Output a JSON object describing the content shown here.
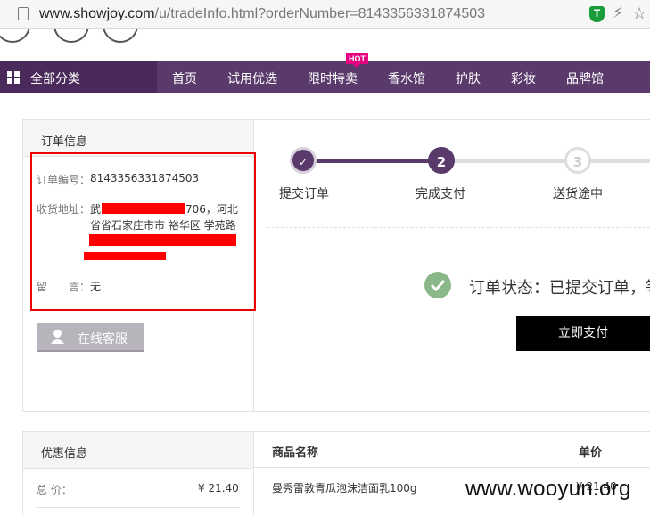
{
  "browser": {
    "url_domain": "www.showjoy.com",
    "url_path": "/u/tradeInfo.html?orderNumber=8143356331874503",
    "ext_t_label": "T",
    "bolt_icon": "⚡",
    "star_icon": "☆"
  },
  "nav": {
    "all_categories": "全部分类",
    "items": [
      "首页",
      "试用优选",
      "限时特卖",
      "香水馆",
      "护肤",
      "彩妆",
      "品牌馆"
    ],
    "hot_badge": "HOT",
    "bg_color": "#5a3a6b"
  },
  "order_info": {
    "title": "订单信息",
    "order_no_label": "订单编号：",
    "order_no": "8143356331874503",
    "address_label": "收货地址：",
    "address_line1_prefix": "武",
    "address_line1_suffix": "706，河北",
    "address_line2": "省省石家庄市市 裕华区 学苑路",
    "message_label": "留　　言：",
    "message": "无"
  },
  "service_button": "在线客服",
  "steps": [
    {
      "number": "✓",
      "label": "提交订单"
    },
    {
      "number": "2",
      "label": "完成支付"
    },
    {
      "number": "3",
      "label": "送货途中"
    }
  ],
  "status": {
    "text": "订单状态：已提交订单，等",
    "pay_button": "立即支付"
  },
  "promo": {
    "title": "优惠信息",
    "total_label": "总 价：",
    "total_value": "¥ 21.40"
  },
  "goods": {
    "col_name": "商品名称",
    "col_price": "单价",
    "item_name": "曼秀雷敦青瓜泡沫洁面乳100g",
    "item_price": "¥ 21.40"
  },
  "watermark": "www.wooyun.org",
  "colors": {
    "accent_purple": "#5a3a6b",
    "redact": "#ff0000",
    "ok_green": "#8ab88a"
  }
}
